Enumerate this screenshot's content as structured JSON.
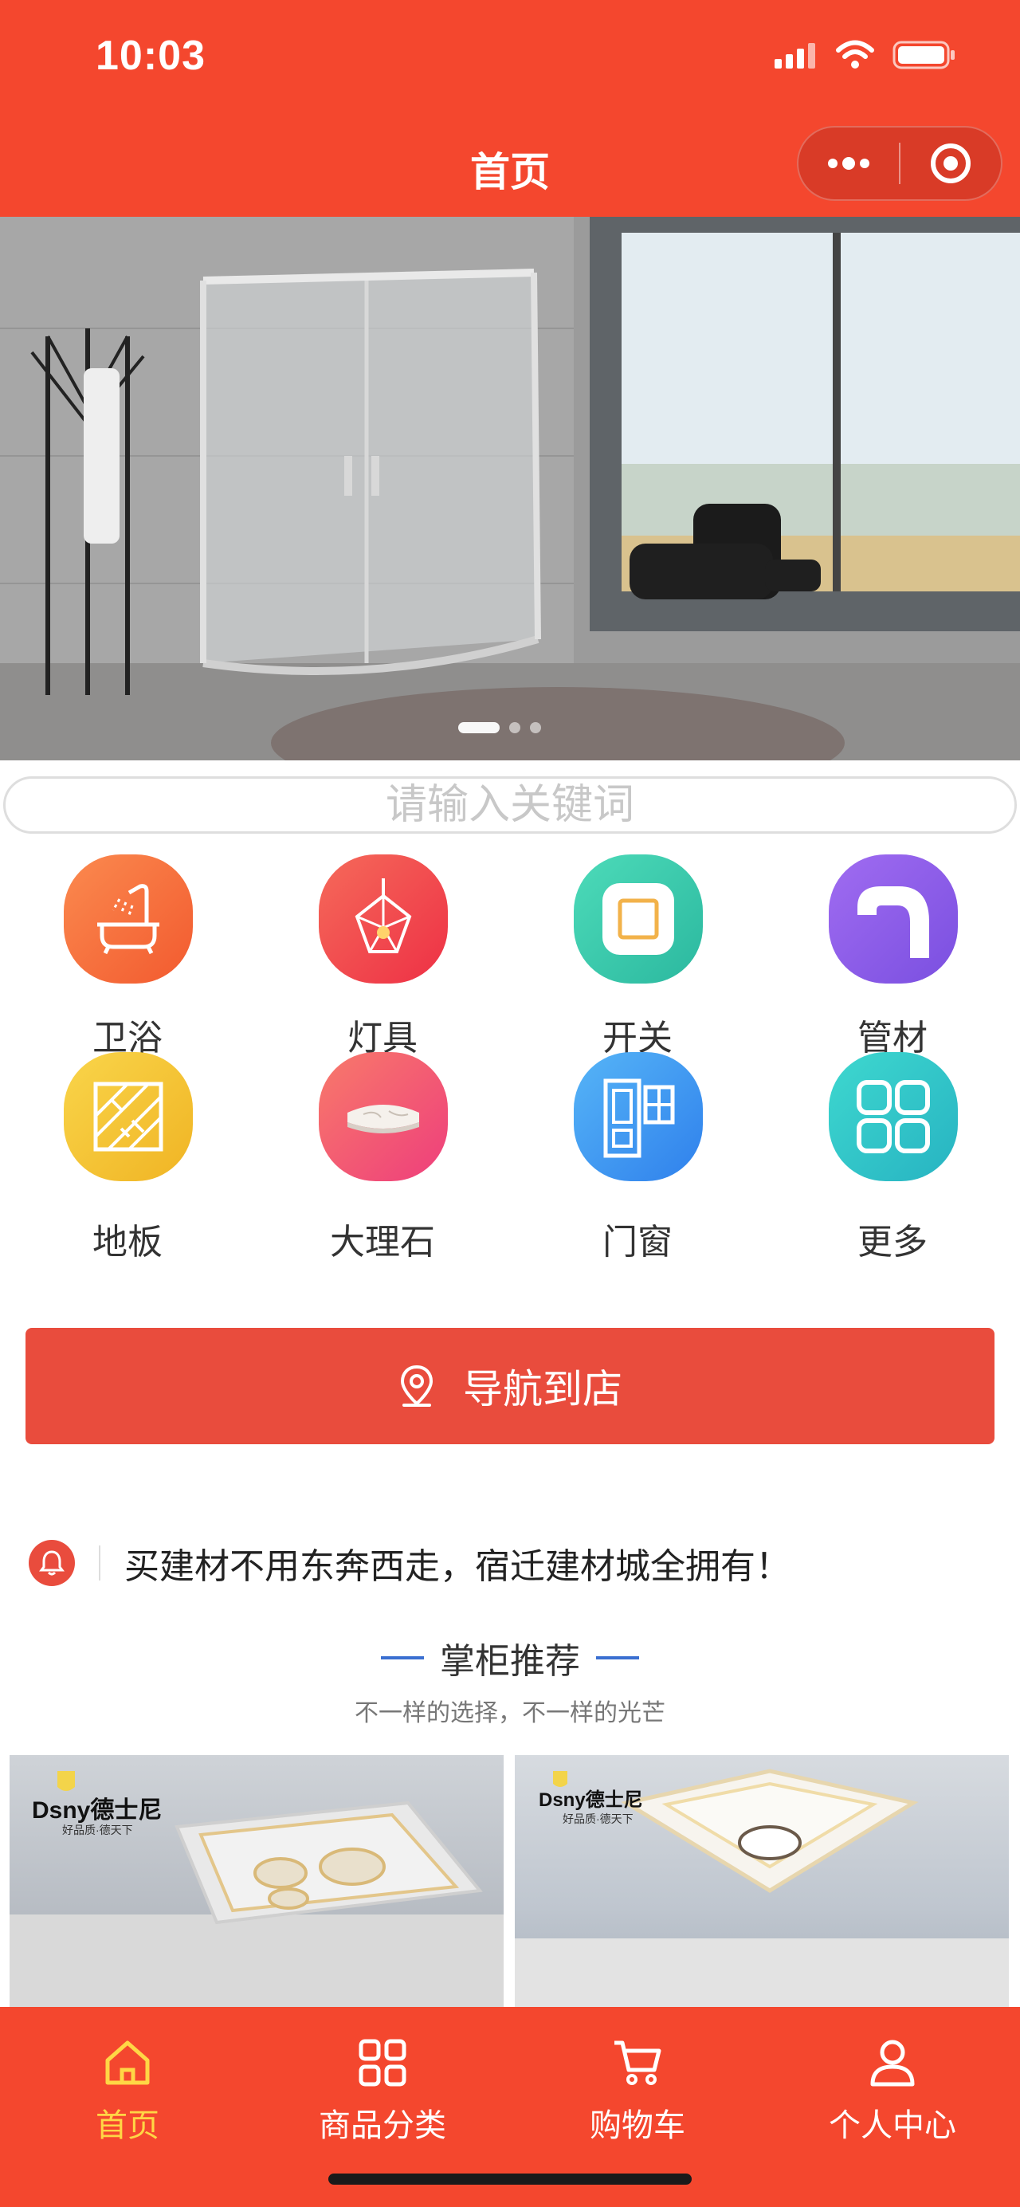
{
  "status_bar": {
    "time": "10:03"
  },
  "header": {
    "title": "首页"
  },
  "banner": {
    "slide_count": 3,
    "active_slide": 1
  },
  "search": {
    "placeholder": "请输入关键词"
  },
  "categories": [
    {
      "label": "卫浴",
      "icon": "bathtub-icon",
      "color": "#f7713f"
    },
    {
      "label": "灯具",
      "icon": "chandelier-icon",
      "color": "#f2454e"
    },
    {
      "label": "开关",
      "icon": "switch-icon",
      "color": "#36c9ab"
    },
    {
      "label": "管材",
      "icon": "pipe-icon",
      "color": "#8b5ee8"
    },
    {
      "label": "地板",
      "icon": "floor-icon",
      "color": "#f4c335"
    },
    {
      "label": "大理石",
      "icon": "marble-icon",
      "color": "#f3507f"
    },
    {
      "label": "门窗",
      "icon": "door-window-icon",
      "color": "#3f9cf2"
    },
    {
      "label": "更多",
      "icon": "grid-more-icon",
      "color": "#2fc6c8"
    }
  ],
  "navigate_button": {
    "label": "导航到店"
  },
  "notice": {
    "text": "买建材不用东奔西走，宿迁建材城全拥有！"
  },
  "recommend": {
    "title": "掌柜推荐",
    "subtitle": "不一样的选择，不一样的光芒"
  },
  "products": [
    {
      "brand": "Dsny德士尼",
      "slogan": "好品质·德天下"
    },
    {
      "brand": "Dsny德士尼",
      "slogan": "好品质·德天下"
    }
  ],
  "tabbar": {
    "items": [
      {
        "label": "首页",
        "icon": "home-icon",
        "active": true
      },
      {
        "label": "商品分类",
        "icon": "category-icon",
        "active": false
      },
      {
        "label": "购物车",
        "icon": "cart-icon",
        "active": false
      },
      {
        "label": "个人中心",
        "icon": "user-icon",
        "active": false
      }
    ]
  },
  "colors": {
    "brand": "#f4472e",
    "button": "#e94c3d",
    "active_tab": "#ffd645",
    "accent_line": "#3a6fd1"
  }
}
